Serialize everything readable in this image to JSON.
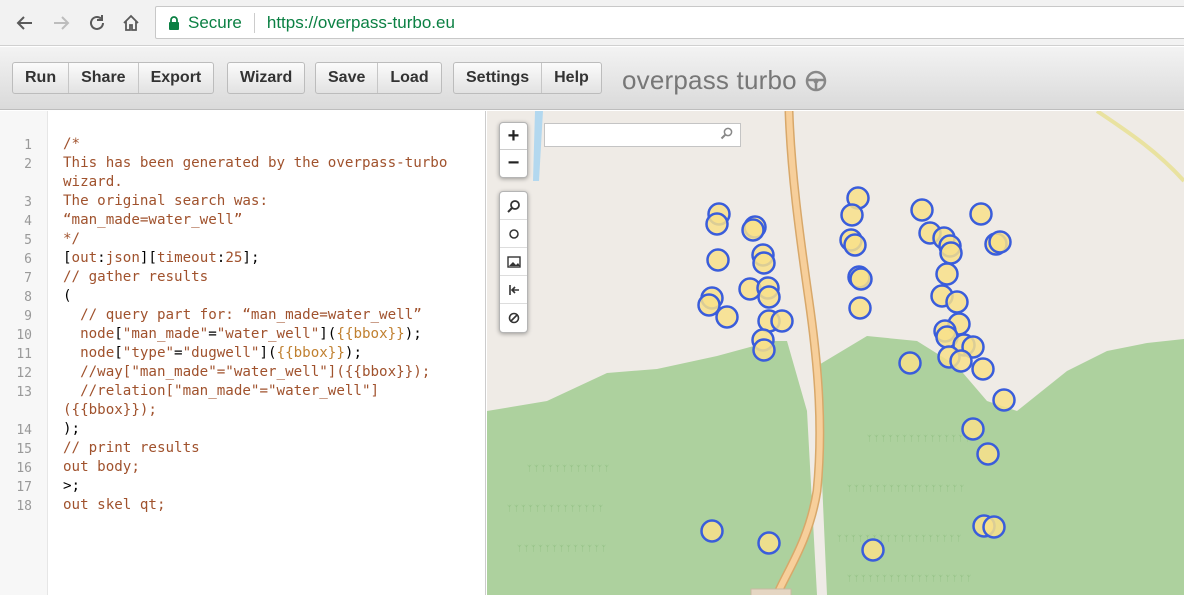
{
  "browser": {
    "secure_label": "Secure",
    "url": "https://overpass-turbo.eu"
  },
  "toolbar": {
    "run": "Run",
    "share": "Share",
    "export": "Export",
    "wizard": "Wizard",
    "save": "Save",
    "load": "Load",
    "settings": "Settings",
    "help": "Help",
    "brand": "overpass turbo"
  },
  "editor": {
    "line_numbers": [
      "1",
      "2",
      "3",
      "4",
      "5",
      "6",
      "7",
      "8",
      "9",
      "10",
      "11",
      "12",
      "13",
      "14",
      "15",
      "16",
      "17",
      "18"
    ],
    "lines": {
      "l1": "/*",
      "l2a": "This has been generated by the overpass-turbo",
      "l2b": "wizard.",
      "l3": "The original search was:",
      "l4": "“man_made=water_well”",
      "l5": "*/",
      "l6_open": "[",
      "l6_out": "out",
      "l6_colon1": ":",
      "l6_json": "json",
      "l6_mid": "][",
      "l6_timeout": "timeout",
      "l6_colon2": ":",
      "l6_25": "25",
      "l6_close": "];",
      "l7": "// gather results",
      "l8": "(",
      "l9": "  // query part for: “man_made=water_well”",
      "l10_node": "  node",
      "l10_b1": "[",
      "l10_k": "\"man_made\"",
      "l10_eq": "=",
      "l10_v": "\"water_well\"",
      "l10_b2": "](",
      "l10_tpl": "{{bbox}}",
      "l10_end": ");",
      "l11_node": "  node",
      "l11_b1": "[",
      "l11_k": "\"type\"",
      "l11_eq": "=",
      "l11_v": "\"dugwell\"",
      "l11_b2": "](",
      "l11_tpl": "{{bbox}}",
      "l11_end": ");",
      "l12": "  //way[\"man_made\"=\"water_well\"]({{bbox}});",
      "l13a": "  //relation[\"man_made\"=\"water_well\"]",
      "l13b": "({{bbox}});",
      "l14": ");",
      "l15": "// print results",
      "l16_out": "out",
      "l16_rest": " body;",
      "l17": ">;",
      "l18_out": "out",
      "l18_rest": " skel qt;"
    }
  },
  "map": {
    "zoom_in": "+",
    "zoom_out": "−",
    "search_placeholder": "",
    "colors": {
      "land": "#efebe6",
      "forest": "#add19e",
      "road": "#f7cf9b",
      "poi_fill": "#f8e08a",
      "poi_stroke": "#3a5ddb",
      "water": "#b3d8ef"
    },
    "tools": [
      "zoom-to-data-icon",
      "locate-icon",
      "image-icon",
      "first-icon",
      "clear-icon"
    ]
  }
}
